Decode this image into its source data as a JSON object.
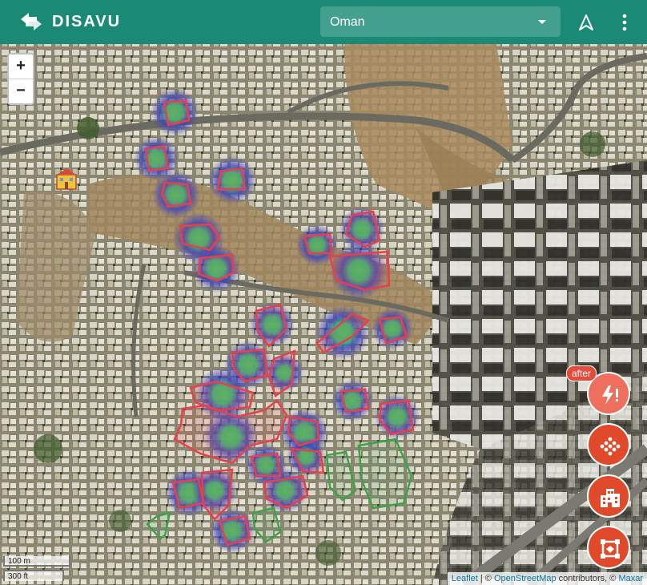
{
  "app": {
    "title": "DISAVU"
  },
  "region_select": {
    "selected": "Oman"
  },
  "map": {
    "zoom_in": "+",
    "zoom_out": "−",
    "scale_metric": "100 m",
    "scale_imperial": "300 ft",
    "attribution": {
      "leaflet": "Leaflet",
      "sep": " | © ",
      "osm": "OpenStreetMap",
      "mid": " contributors, © ",
      "maxar": "Maxar"
    }
  },
  "layers": {
    "after_label": "after",
    "items": [
      {
        "icon": "damage-alert-icon",
        "active": false
      },
      {
        "icon": "points-cluster-icon",
        "active": true
      },
      {
        "icon": "buildings-icon",
        "active": true
      },
      {
        "icon": "footprint-outline-icon",
        "active": true
      }
    ]
  },
  "colors": {
    "appbar": "#1a8a76",
    "damaged_outline": "#e8404a",
    "undamaged_outline": "#3da14a",
    "heat_core": "#3fbf63",
    "heat_halo": "#3a3ec0",
    "fab": "#e04a2a"
  }
}
